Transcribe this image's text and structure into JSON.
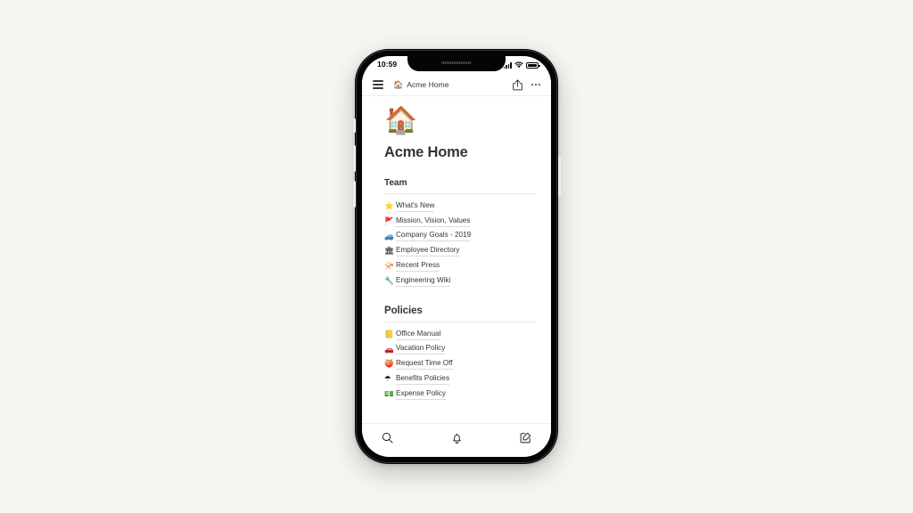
{
  "device": {
    "status_bar": {
      "time": "10:59",
      "cellular_icon": "cellular-signal-icon",
      "wifi_icon": "wifi-icon",
      "battery_icon": "battery-icon"
    },
    "home_indicator": "home-indicator"
  },
  "nav_bar": {
    "menu_icon": "hamburger-menu-icon",
    "breadcrumb_emoji": "🏠",
    "breadcrumb_label": "Acme Home",
    "share_icon": "share-icon",
    "more_icon": "more-options-icon"
  },
  "page": {
    "icon": "🏠",
    "title": "Acme Home"
  },
  "sections": [
    {
      "id": "team",
      "heading": "Team",
      "items": [
        {
          "emoji": "⭐",
          "label": "What's New",
          "icon_name": "star-icon"
        },
        {
          "emoji": "🚩",
          "label": "Mission, Vision, Values",
          "icon_name": "triangular-flag-icon"
        },
        {
          "emoji": "🚙",
          "label": "Company Goals - 2019",
          "icon_name": "car-icon"
        },
        {
          "emoji": "🏛",
          "label": "Employee Directory",
          "icon_name": "classical-building-icon"
        },
        {
          "emoji": "📯",
          "label": "Recent Press",
          "icon_name": "postal-horn-icon"
        },
        {
          "emoji": "🔧",
          "label": "Engineering Wiki",
          "icon_name": "wrench-icon"
        }
      ]
    },
    {
      "id": "policies",
      "heading": "Policies",
      "items": [
        {
          "emoji": "📒",
          "label": "Office Manual",
          "icon_name": "notebook-icon"
        },
        {
          "emoji": "🚗",
          "label": "Vacation Policy",
          "icon_name": "car-icon"
        },
        {
          "emoji": "🍑",
          "label": "Request Time Off",
          "icon_name": "peach-icon"
        },
        {
          "emoji": "☂",
          "label": "Benefits Policies",
          "icon_name": "umbrella-icon"
        },
        {
          "emoji": "💵",
          "label": "Expense Policy",
          "icon_name": "money-icon"
        }
      ]
    }
  ],
  "tab_bar": {
    "search_icon": "search-icon",
    "notifications_icon": "bell-icon",
    "compose_icon": "compose-icon"
  },
  "colors": {
    "page_background": "#f6f5f1",
    "screen_background": "#ffffff",
    "text_primary": "#37352f",
    "divider": "#eceae5",
    "device_frame": "#050505"
  }
}
